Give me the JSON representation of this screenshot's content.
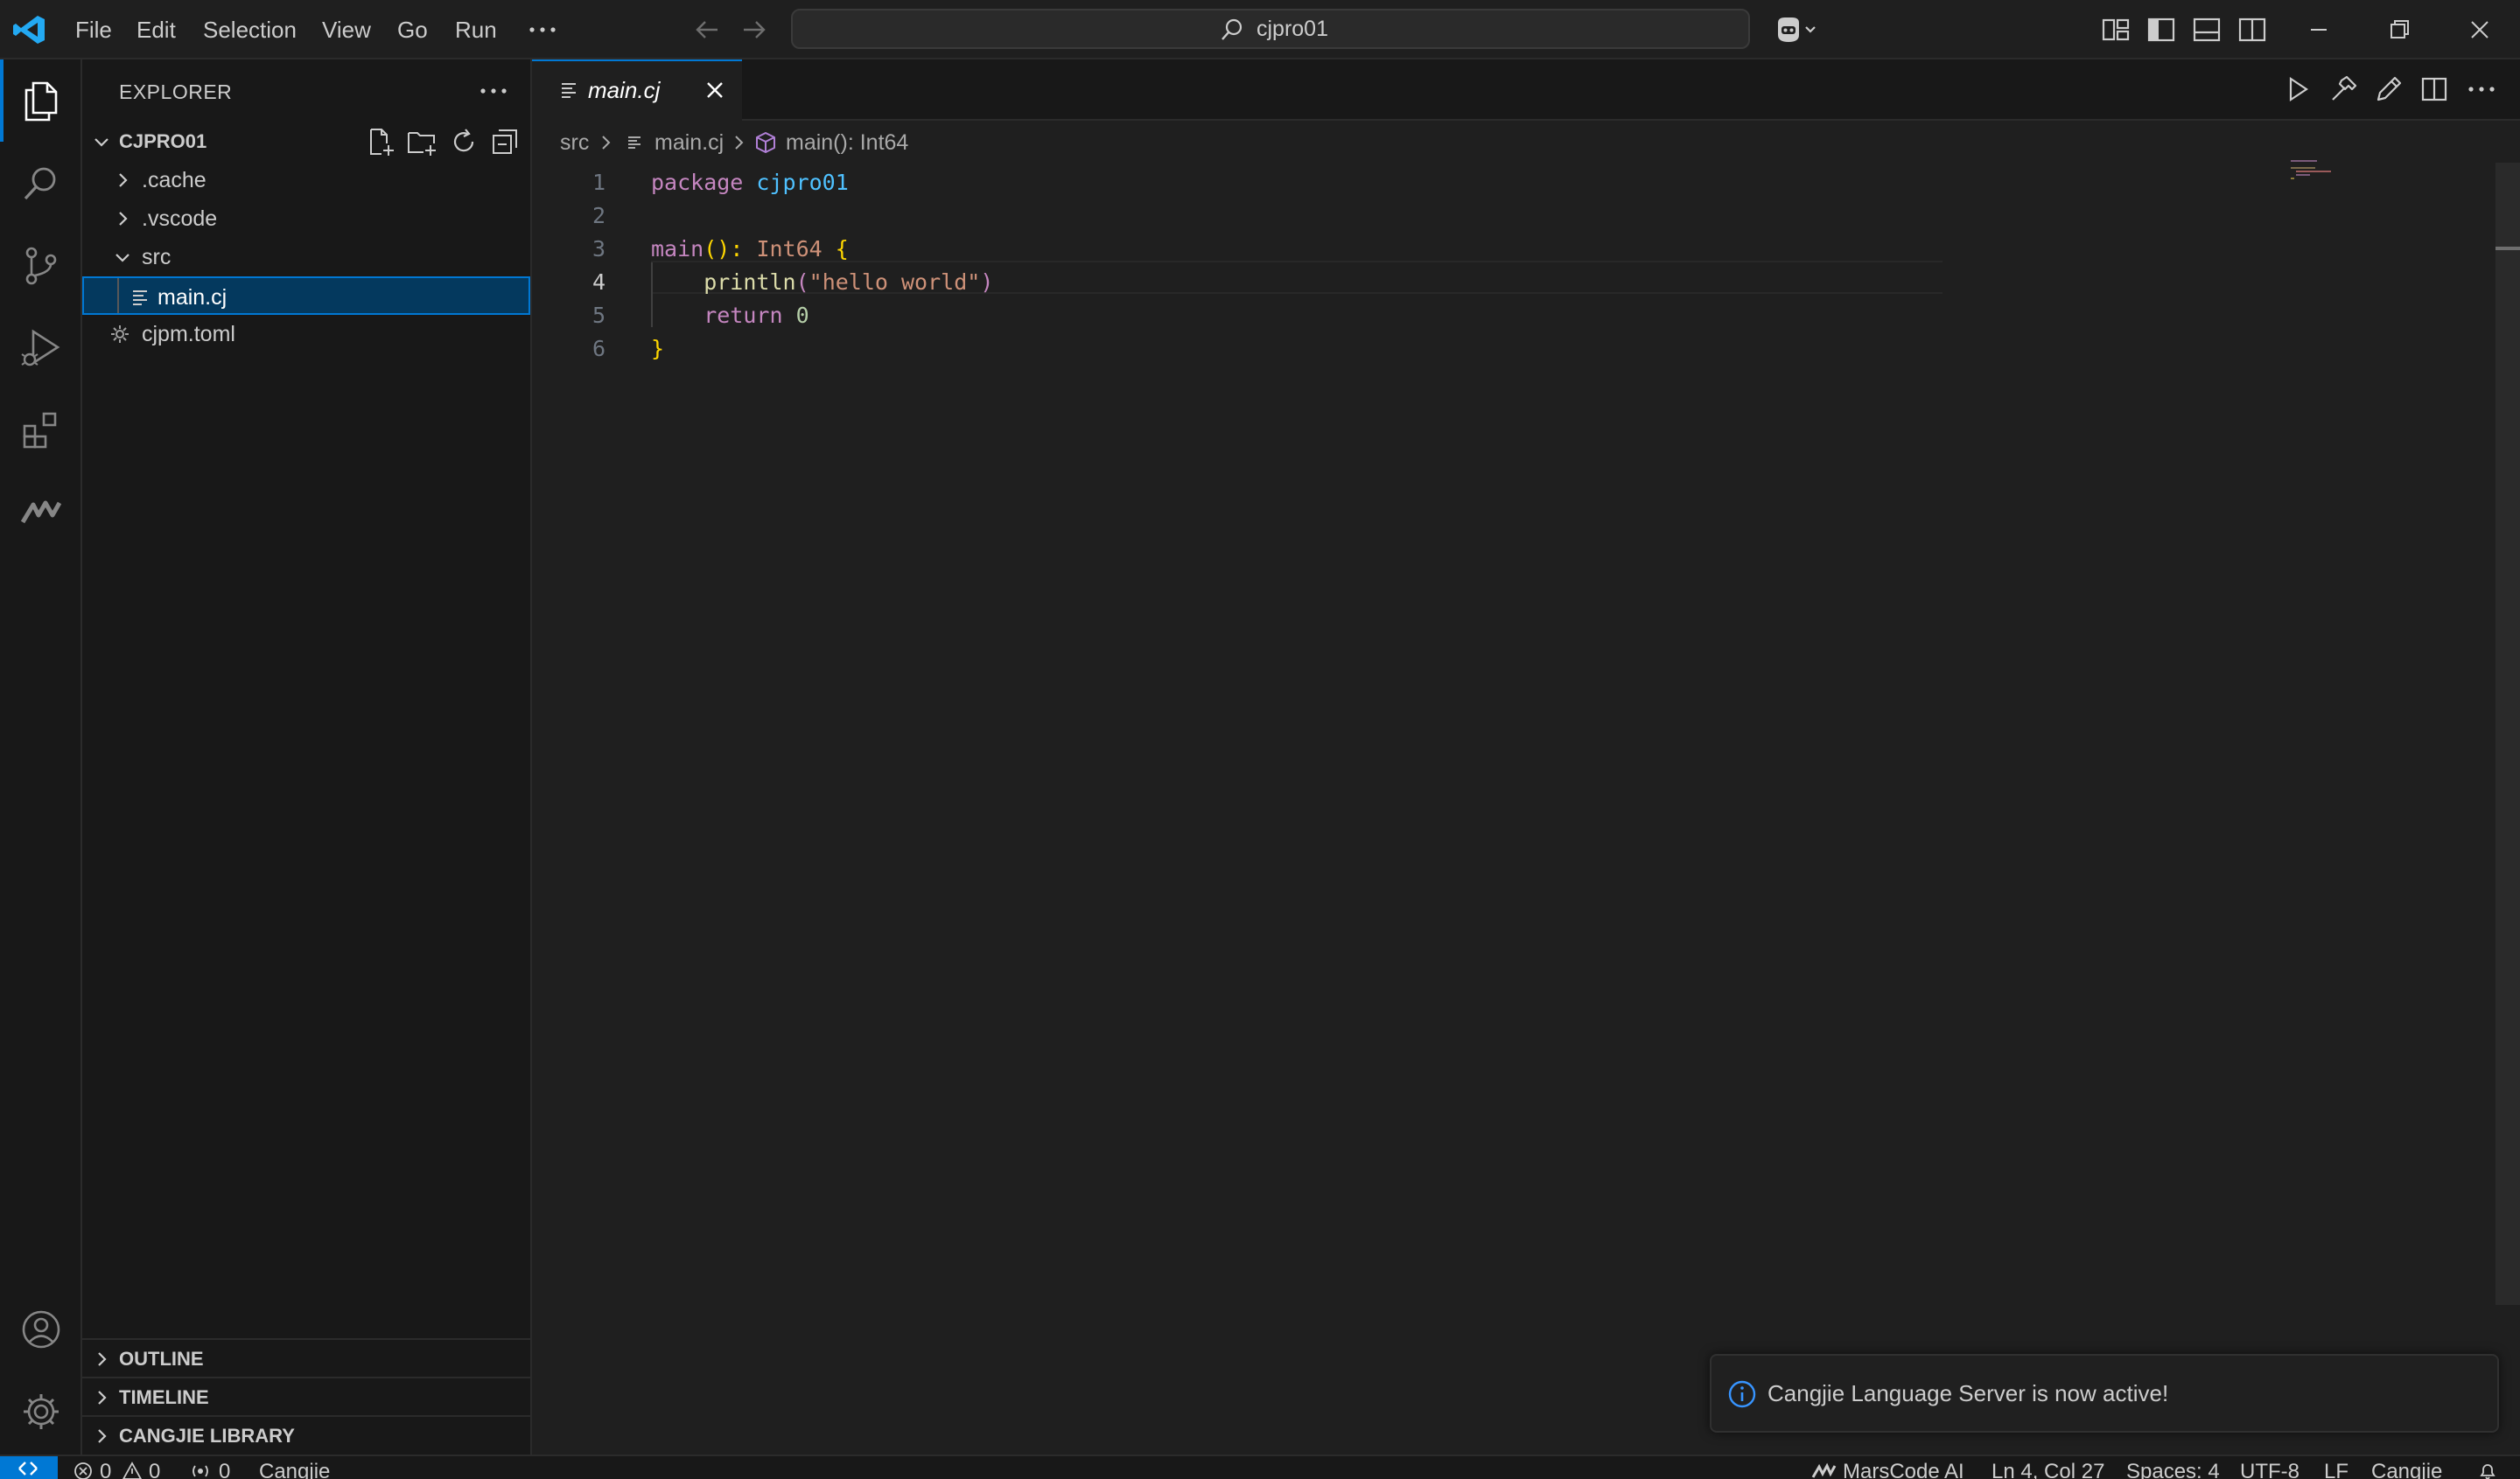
{
  "menu": {
    "file": "File",
    "edit": "Edit",
    "selection": "Selection",
    "view": "View",
    "go": "Go",
    "run": "Run",
    "more": "···"
  },
  "command_center": {
    "label": "cjpro01",
    "icon": "search-icon"
  },
  "explorer": {
    "title": "EXPLORER",
    "more": "···",
    "folder_name": "CJPRO01",
    "tree": [
      {
        "label": ".cache",
        "type": "folder",
        "expanded": false
      },
      {
        "label": ".vscode",
        "type": "folder",
        "expanded": false
      },
      {
        "label": "src",
        "type": "folder",
        "expanded": true
      },
      {
        "label": "main.cj",
        "type": "file",
        "selected": true
      },
      {
        "label": "cjpm.toml",
        "type": "file",
        "icon": "gear-icon"
      }
    ],
    "sections": [
      "OUTLINE",
      "TIMELINE",
      "CANGJIE LIBRARY"
    ]
  },
  "editor": {
    "tab": {
      "label": "main.cj",
      "active": true
    },
    "breadcrumb": {
      "folder": "src",
      "file": "main.cj",
      "symbol": "main(): Int64"
    },
    "current_line": 4,
    "lines": [
      {
        "n": "1",
        "tokens": [
          {
            "t": "package ",
            "c": "kw"
          },
          {
            "t": "cjpro01",
            "c": "ns"
          }
        ]
      },
      {
        "n": "2",
        "tokens": []
      },
      {
        "n": "3",
        "tokens": [
          {
            "t": "main",
            "c": "pn"
          },
          {
            "t": "(): ",
            "c": "br"
          },
          {
            "t": "Int64",
            "c": "ty"
          },
          {
            "t": " {",
            "c": "br"
          }
        ]
      },
      {
        "n": "4",
        "tokens": [
          {
            "t": "    println",
            "c": "fn"
          },
          {
            "t": "(",
            "c": "pn"
          },
          {
            "t": "\"hello world\"",
            "c": "st"
          },
          {
            "t": ")",
            "c": "pn"
          }
        ]
      },
      {
        "n": "5",
        "tokens": [
          {
            "t": "    return ",
            "c": "kw"
          },
          {
            "t": "0",
            "c": "nm"
          }
        ]
      },
      {
        "n": "6",
        "tokens": [
          {
            "t": "}",
            "c": "br"
          }
        ]
      }
    ]
  },
  "notification": {
    "message": "Cangjie Language Server is now active!",
    "icon": "info-icon"
  },
  "status": {
    "errors": "0",
    "warnings": "0",
    "ports": "0",
    "language_mode": "Cangjie",
    "marscode": "MarsCode AI",
    "position": "Ln 4, Col 27",
    "spaces": "Spaces: 4",
    "encoding": "UTF-8",
    "eol": "LF",
    "language": "Cangjie"
  },
  "colors": {
    "accent": "#0078d4",
    "background": "#1f1f1f",
    "sidebar": "#181818",
    "selection": "#04395e",
    "logo": "#23a9f2"
  }
}
